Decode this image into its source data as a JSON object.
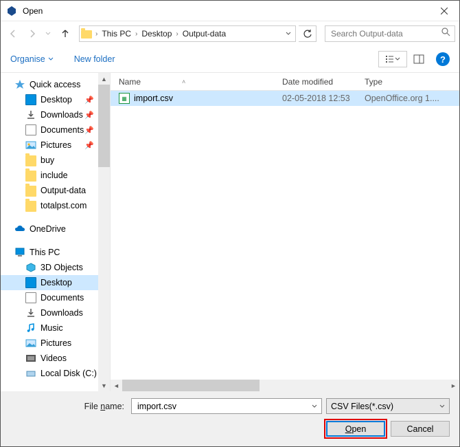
{
  "title": "Open",
  "breadcrumbs": [
    "This PC",
    "Desktop",
    "Output-data"
  ],
  "search_placeholder": "Search Output-data",
  "toolbar": {
    "organise": "Organise",
    "new_folder": "New folder"
  },
  "columns": {
    "name": "Name",
    "date": "Date modified",
    "type": "Type"
  },
  "file": {
    "name": "import.csv",
    "date": "02-05-2018 12:53",
    "type": "OpenOffice.org 1...."
  },
  "sidebar": {
    "quick_access": "Quick access",
    "items_pinned": [
      "Desktop",
      "Downloads",
      "Documents",
      "Pictures"
    ],
    "items_recent": [
      "buy",
      "include",
      "Output-data",
      "totalpst.com"
    ],
    "onedrive": "OneDrive",
    "this_pc": "This PC",
    "pc_items": [
      "3D Objects",
      "Desktop",
      "Documents",
      "Downloads",
      "Music",
      "Pictures",
      "Videos",
      "Local Disk (C:)"
    ]
  },
  "footer": {
    "label": "File name:",
    "value": "import.csv",
    "filter": "CSV Files(*.csv)",
    "open": "Open",
    "cancel": "Cancel"
  }
}
